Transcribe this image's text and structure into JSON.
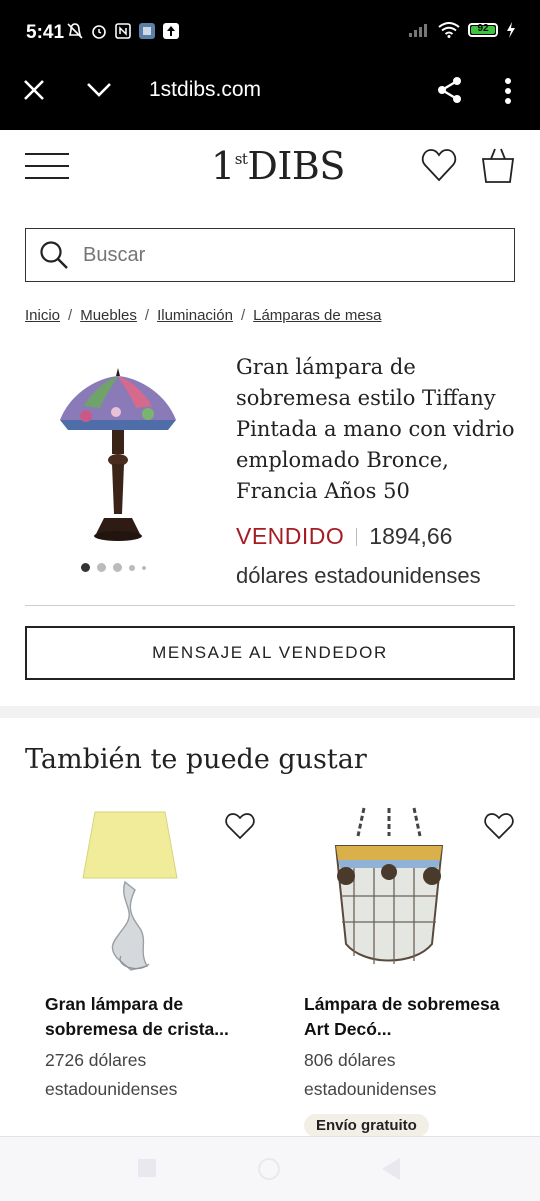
{
  "status_bar": {
    "time": "5:41",
    "battery": "92"
  },
  "browser": {
    "url": "1stdibs.com"
  },
  "header": {
    "logo_main": "DIBS",
    "logo_prefix_top": "st",
    "logo_prefix_digit": "1"
  },
  "search": {
    "placeholder": "Buscar"
  },
  "breadcrumb": {
    "items": [
      "Inicio",
      "Muebles",
      "Iluminación",
      "Lámparas de mesa"
    ],
    "separator": "/"
  },
  "product": {
    "title": "Gran lámpara de sobremesa estilo Tiffany Pintada a mano con vidrio emplomado Bronce, Francia Años 50",
    "status": "VENDIDO",
    "price": "1894,66",
    "currency": "dólares estadounidenses",
    "image_count": 5,
    "image_index": 1
  },
  "actions": {
    "message_seller": "MENSAJE AL VENDEDOR"
  },
  "recommendations": {
    "title": "También te puede gustar",
    "items": [
      {
        "title": "Gran lámpara de sobremesa de crista...",
        "price": "2726 dólares estadounidenses",
        "badge": ""
      },
      {
        "title": "Lámpara de sobremesa Art Decó...",
        "price": "806 dólares estadounidenses",
        "badge": "Envío gratuito"
      }
    ]
  },
  "colors": {
    "sold": "#a51d24",
    "badge_bg": "#f2efe6",
    "browser_bar": "#000000"
  }
}
